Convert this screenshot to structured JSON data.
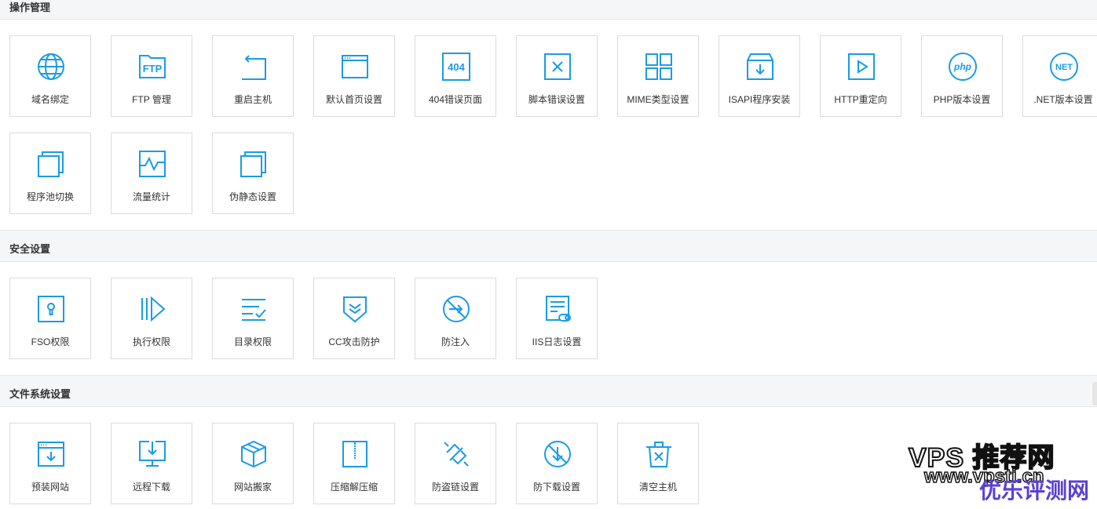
{
  "accent_color": "#1a9be8",
  "sections": [
    {
      "title": "操作管理",
      "tiles": [
        {
          "label": "域名绑定",
          "icon": "globe-icon"
        },
        {
          "label": "FTP 管理",
          "icon": "ftp-folder-icon"
        },
        {
          "label": "重启主机",
          "icon": "restart-arrow-icon"
        },
        {
          "label": "默认首页设置",
          "icon": "browser-window-icon"
        },
        {
          "label": "404错误页面",
          "icon": "error-404-icon"
        },
        {
          "label": "脚本错误设置",
          "icon": "close-box-icon"
        },
        {
          "label": "MIME类型设置",
          "icon": "grid-icon"
        },
        {
          "label": "ISAPI程序安装",
          "icon": "install-box-icon"
        },
        {
          "label": "HTTP重定向",
          "icon": "play-redirect-icon"
        },
        {
          "label": "PHP版本设置",
          "icon": "php-icon"
        },
        {
          "label": ".NET版本设置",
          "icon": "net-icon"
        },
        {
          "label": "程序池切换",
          "icon": "stacked-windows-icon"
        },
        {
          "label": "流量统计",
          "icon": "traffic-wave-icon"
        },
        {
          "label": "伪静态设置",
          "icon": "stacked-windows-icon"
        }
      ]
    },
    {
      "title": "安全设置",
      "tiles": [
        {
          "label": "FSO权限",
          "icon": "keyhole-icon"
        },
        {
          "label": "执行权限",
          "icon": "execute-icon"
        },
        {
          "label": "目录权限",
          "icon": "checklist-icon"
        },
        {
          "label": "CC攻击防护",
          "icon": "shield-icon"
        },
        {
          "label": "防注入",
          "icon": "no-injection-icon"
        },
        {
          "label": "IIS日志设置",
          "icon": "log-document-icon"
        }
      ]
    },
    {
      "title": "文件系统设置",
      "tiles": [
        {
          "label": "预装网站",
          "icon": "site-download-icon"
        },
        {
          "label": "远程下载",
          "icon": "remote-download-icon"
        },
        {
          "label": "网站搬家",
          "icon": "package-box-icon"
        },
        {
          "label": "压缩解压缩",
          "icon": "zip-file-icon"
        },
        {
          "label": "防盗链设置",
          "icon": "broken-link-icon"
        },
        {
          "label": "防下载设置",
          "icon": "no-download-icon"
        },
        {
          "label": "清空主机",
          "icon": "trash-icon"
        }
      ]
    }
  ],
  "watermark": {
    "main": "VPS 推荐网",
    "url": "www.vpsti.cn",
    "sub": "优乐评测网"
  }
}
